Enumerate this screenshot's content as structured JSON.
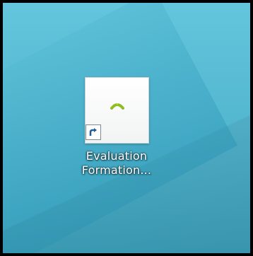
{
  "desktop": {
    "shortcut": {
      "label_line1": "Evaluation",
      "label_line2": "Formation...",
      "app_icon": "green-arc-icon",
      "overlay_icon": "shortcut-arrow-icon"
    }
  },
  "colors": {
    "desktop_top": "#63c6dc",
    "desktop_bottom": "#3fa5c0",
    "icon_green": "#8fbc1f",
    "arrow_blue": "#1f5d9c"
  }
}
